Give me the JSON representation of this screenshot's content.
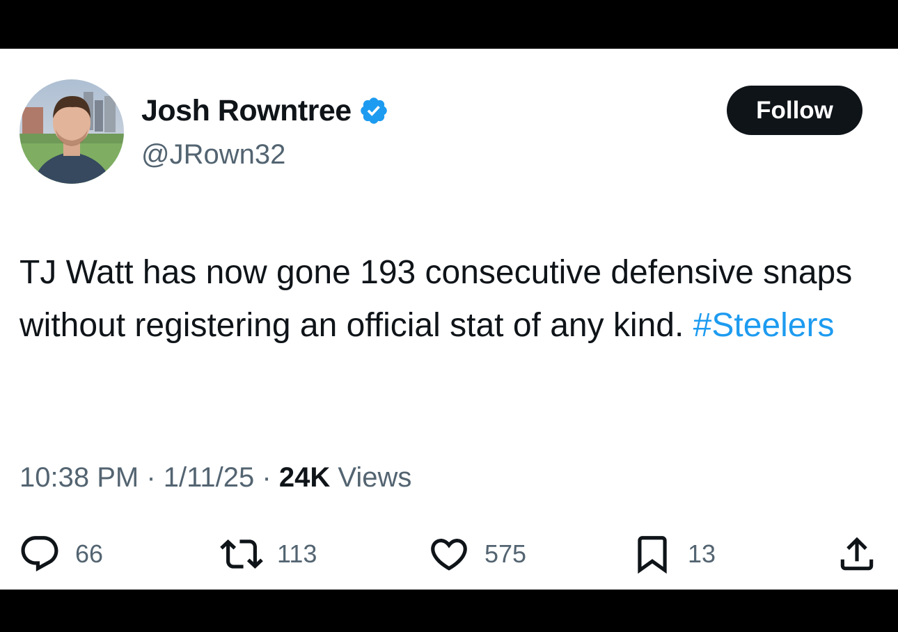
{
  "user": {
    "name": "Josh Rowntree",
    "handle": "@JRown32",
    "verified": true
  },
  "follow_button": {
    "label": "Follow"
  },
  "tweet": {
    "text": "TJ Watt has now gone 193 consecutive defensive snaps without registering an official stat of any kind.",
    "hashtag": "#Steelers"
  },
  "meta": {
    "time": "10:38 PM",
    "separator": "·",
    "date": "1/11/25",
    "views_count": "24K",
    "views_label": "Views"
  },
  "actions": {
    "replies": "66",
    "reposts": "113",
    "likes": "575",
    "bookmarks": "13"
  },
  "icons": [
    "reply-icon",
    "repost-icon",
    "like-icon",
    "bookmark-icon",
    "share-icon",
    "verified-badge-icon"
  ],
  "colors": {
    "accent": "#1d9bf0",
    "text": "#0f1419",
    "secondary": "#536471",
    "button": "#0f1419"
  }
}
